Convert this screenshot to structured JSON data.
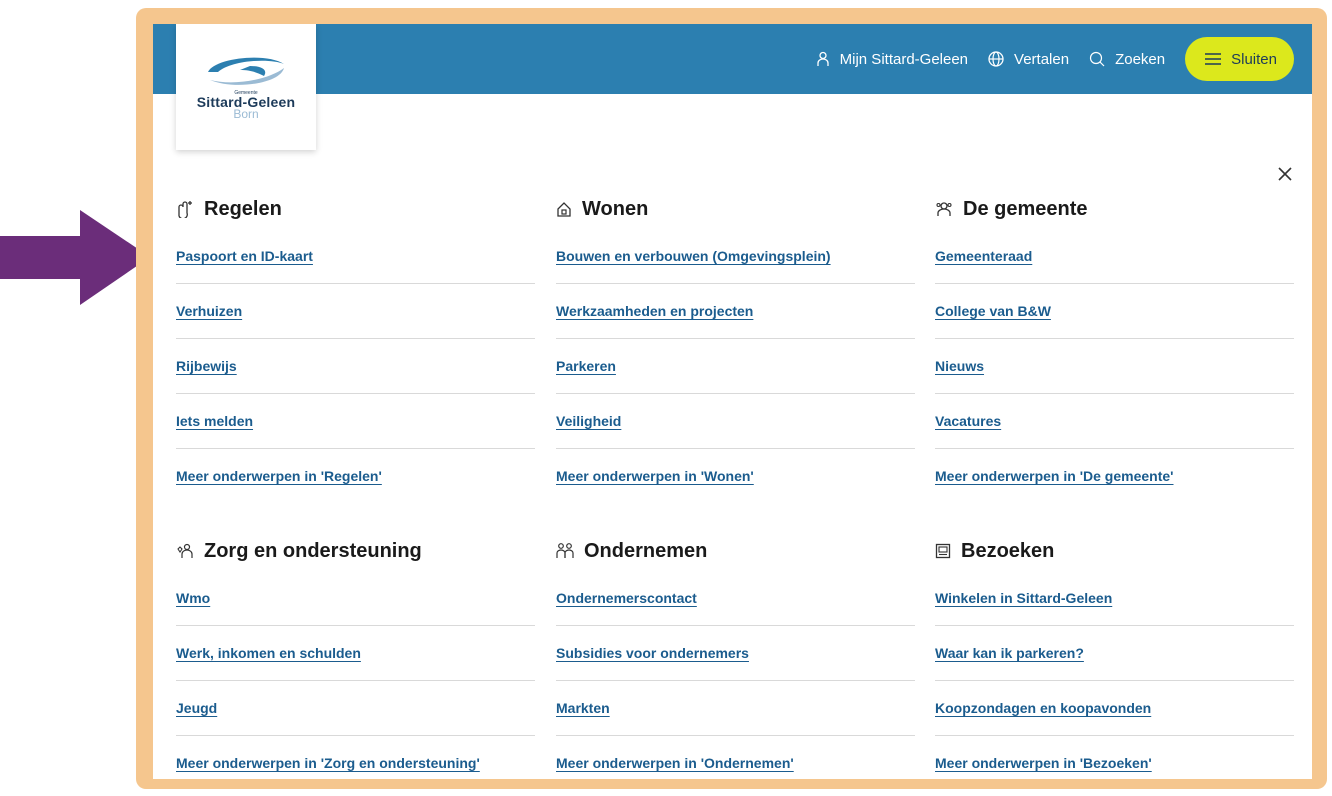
{
  "header": {
    "mijn_label": "Mijn Sittard-Geleen",
    "translate_label": "Vertalen",
    "search_label": "Zoeken",
    "close_menu_label": "Sluiten"
  },
  "logo": {
    "small_text": "Gemeente",
    "main_text": "Sittard-Geleen",
    "sub_text": "Born"
  },
  "colors": {
    "frame": "#f5c68e",
    "topbar": "#2c7fb0",
    "close_button": "#dce81c",
    "link": "#1b5c8e",
    "arrow": "#6b2d7a"
  },
  "icons": {
    "user": "person-icon",
    "translate": "globe-icon",
    "search": "search-icon",
    "menu": "hamburger-icon",
    "close": "close-icon"
  },
  "menu": {
    "sections": [
      {
        "title": "Regelen",
        "icon": "regelen-icon",
        "links": [
          "Paspoort en ID-kaart",
          "Verhuizen",
          "Rijbewijs",
          "Iets melden",
          "Meer onderwerpen in 'Regelen'"
        ]
      },
      {
        "title": "Wonen",
        "icon": "home-icon",
        "links": [
          "Bouwen en verbouwen (Omgevingsplein)",
          "Werkzaamheden en projecten",
          "Parkeren",
          "Veiligheid",
          "Meer onderwerpen in 'Wonen'"
        ]
      },
      {
        "title": "De gemeente",
        "icon": "gemeente-icon",
        "links": [
          "Gemeenteraad",
          "College van B&W",
          "Nieuws",
          "Vacatures",
          "Meer onderwerpen in 'De gemeente'"
        ]
      },
      {
        "title": "Zorg en ondersteuning",
        "icon": "care-icon",
        "links": [
          "Wmo",
          "Werk, inkomen en schulden",
          "Jeugd",
          "Meer onderwerpen in 'Zorg en ondersteuning'"
        ]
      },
      {
        "title": "Ondernemen",
        "icon": "business-icon",
        "links": [
          "Ondernemerscontact",
          "Subsidies voor ondernemers",
          "Markten",
          "Meer onderwerpen in 'Ondernemen'"
        ]
      },
      {
        "title": "Bezoeken",
        "icon": "visit-icon",
        "links": [
          "Winkelen in Sittard-Geleen",
          "Waar kan ik parkeren?",
          "Koopzondagen en koopavonden",
          "Meer onderwerpen in 'Bezoeken'"
        ]
      }
    ]
  }
}
